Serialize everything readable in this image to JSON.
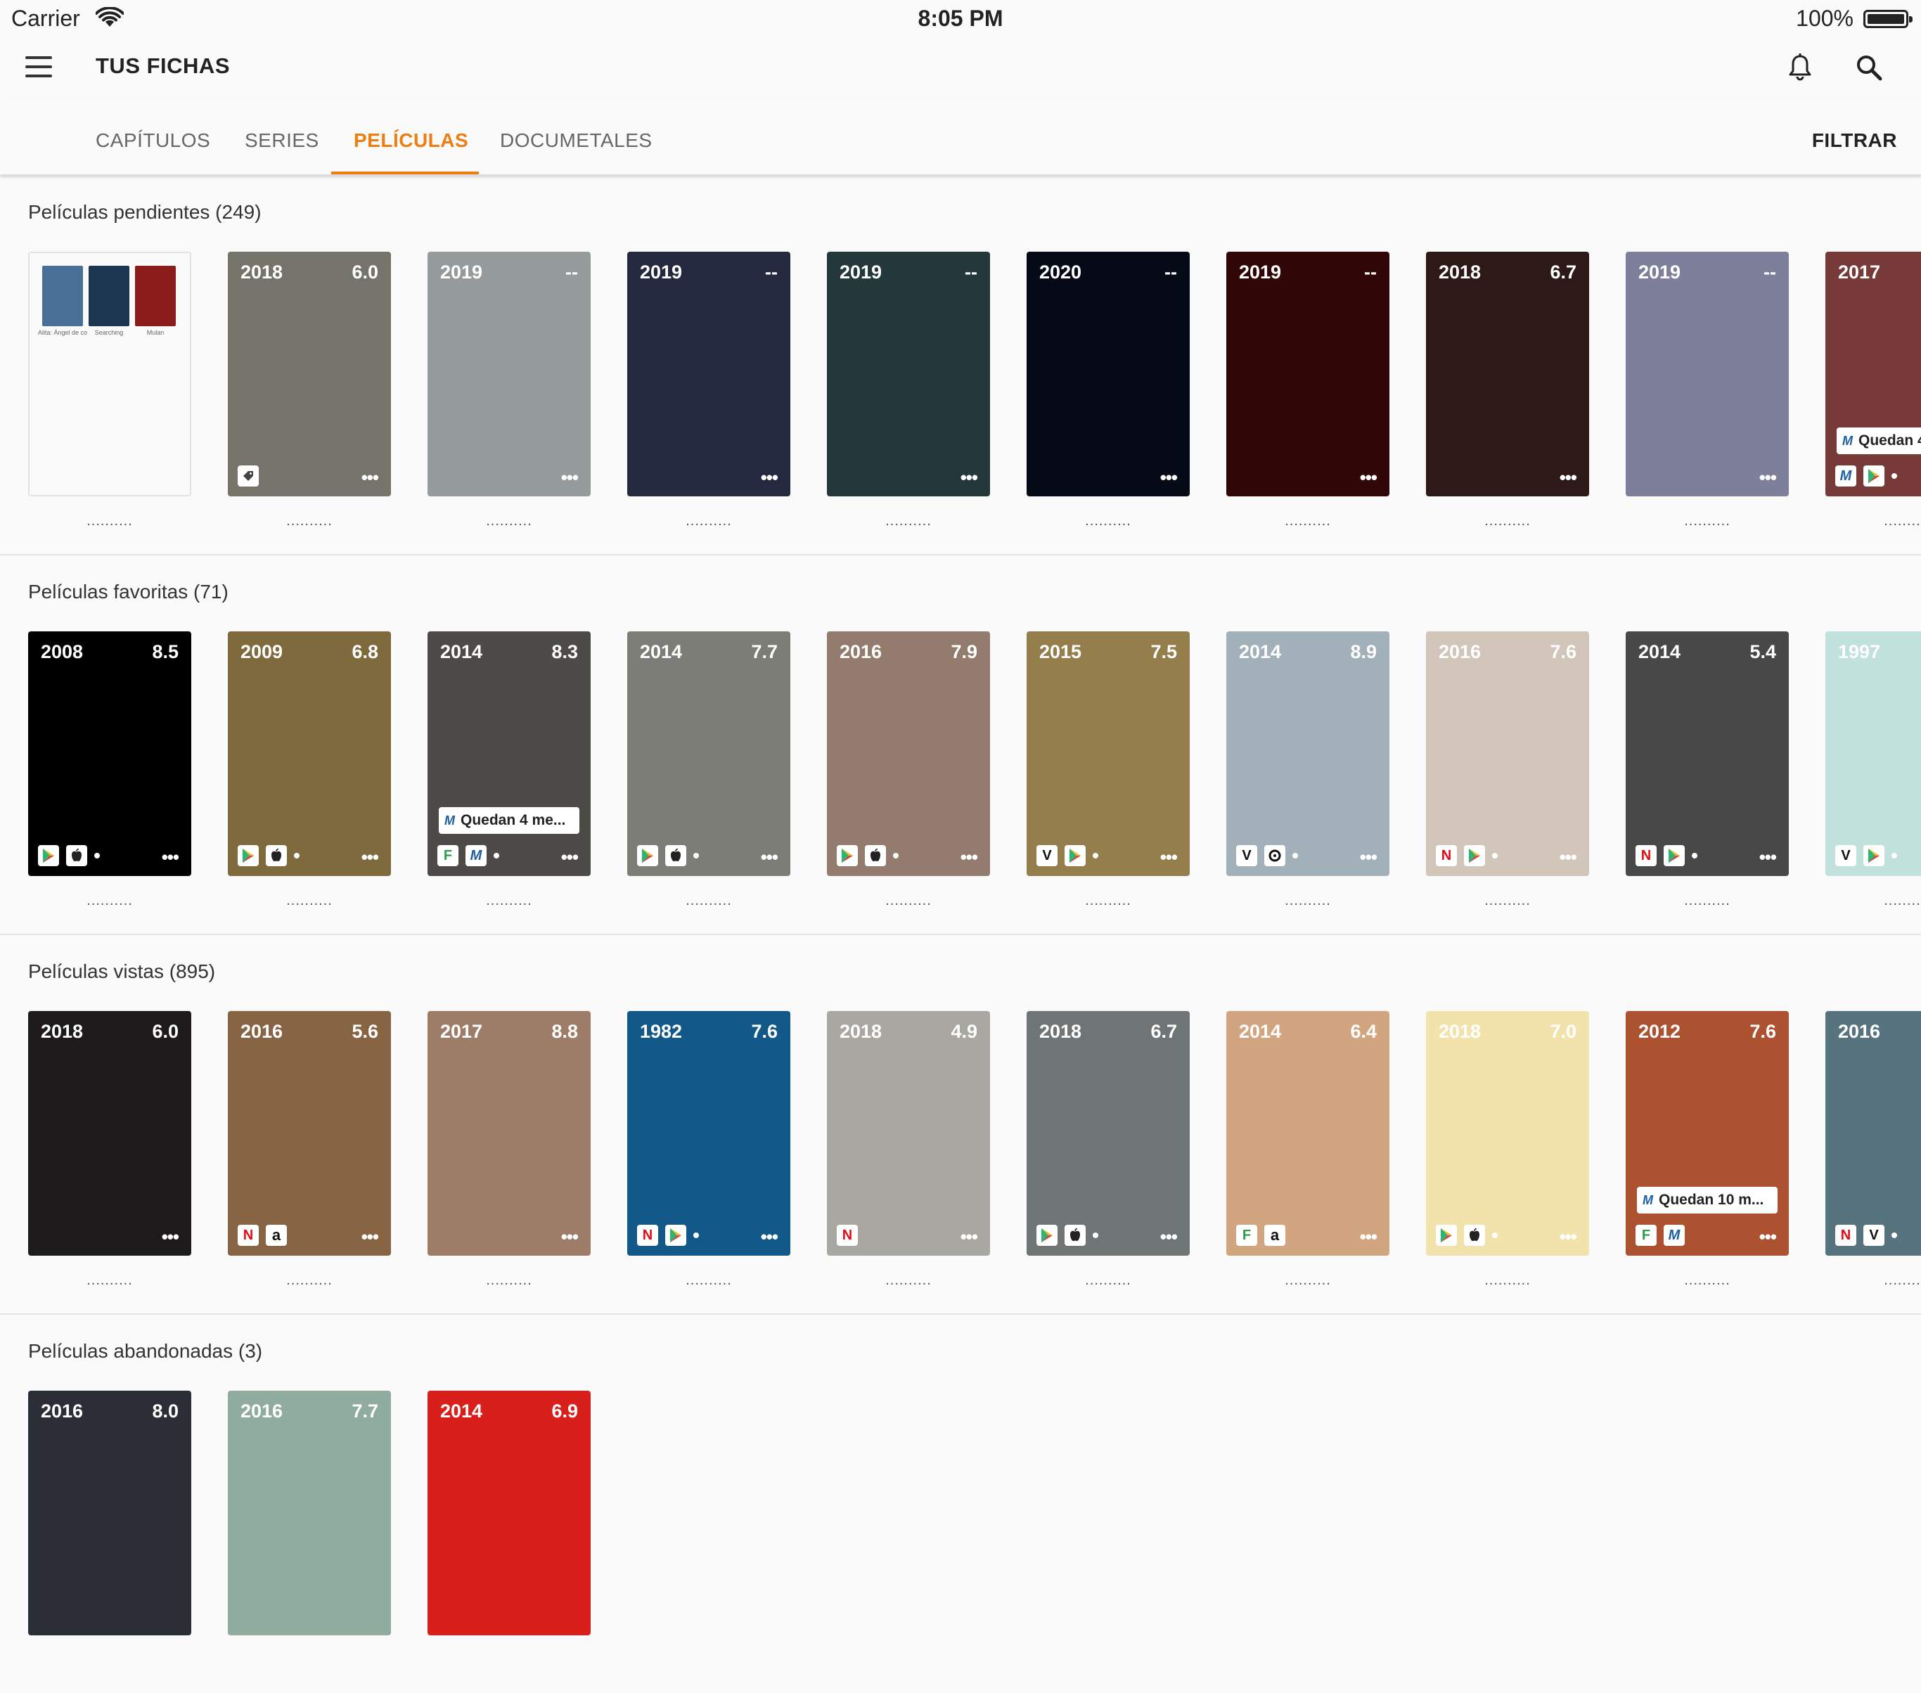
{
  "status": {
    "carrier": "Carrier",
    "time": "8:05 PM",
    "battery": "100%"
  },
  "app": {
    "title": "TUS FICHAS",
    "filter": "FILTRAR"
  },
  "tabs": [
    {
      "label": "CAPÍTULOS"
    },
    {
      "label": "SERIES"
    },
    {
      "label": "PELÍCULAS"
    },
    {
      "label": "DOCUMETALES"
    }
  ],
  "active_tab": "PELÍCULAS",
  "sections": [
    {
      "title": "Películas pendientes (249)",
      "collage": {
        "captions": [
          "Alita: Ángel de co...",
          "Searching",
          "Mulan"
        ],
        "colors": [
          "#4a6f96",
          "#1c3551",
          "#8a1c1c"
        ]
      },
      "cards": [
        {
          "year": "2018",
          "rating": "6.0",
          "color": "#75746a",
          "providers": [
            "tag"
          ],
          "caption": ".........."
        },
        {
          "year": "2019",
          "rating": "--",
          "color": "#959b9b",
          "providers": [],
          "caption": ".........."
        },
        {
          "year": "2019",
          "rating": "--",
          "color": "#242940",
          "providers": [],
          "caption": ".........."
        },
        {
          "year": "2019",
          "rating": "--",
          "color": "#24383b",
          "providers": [],
          "caption": ".........."
        },
        {
          "year": "2020",
          "rating": "--",
          "color": "#050a16",
          "providers": [],
          "caption": ".........."
        },
        {
          "year": "2019",
          "rating": "--",
          "color": "#300607",
          "providers": [],
          "caption": ".........."
        },
        {
          "year": "2018",
          "rating": "6.7",
          "color": "#2d1a16",
          "providers": [],
          "caption": ".........."
        },
        {
          "year": "2019",
          "rating": "--",
          "color": "#7e7f9a",
          "providers": [],
          "caption": ".........."
        },
        {
          "year": "2017",
          "rating": "",
          "color": "#773a38",
          "note": "Quedan 4",
          "providers": [
            "M",
            "play",
            "dot"
          ],
          "caption": ".........."
        }
      ]
    },
    {
      "title": "Películas favoritas (71)",
      "cards": [
        {
          "year": "2008",
          "rating": "8.5",
          "color": "#000000",
          "providers": [
            "play",
            "apple",
            "dot"
          ],
          "caption": ".........."
        },
        {
          "year": "2009",
          "rating": "6.8",
          "color": "#7e6a3c",
          "providers": [
            "play",
            "apple",
            "dot"
          ],
          "caption": ".........."
        },
        {
          "year": "2014",
          "rating": "8.3",
          "color": "#4d4b47",
          "note": "Quedan 4 me...",
          "providers": [
            "F",
            "M",
            "dot"
          ],
          "caption": ".........."
        },
        {
          "year": "2014",
          "rating": "7.7",
          "color": "#7d7d77",
          "providers": [
            "play",
            "apple",
            "dot"
          ],
          "caption": ".........."
        },
        {
          "year": "2016",
          "rating": "7.9",
          "color": "#937c6d",
          "providers": [
            "play",
            "apple",
            "dot"
          ],
          "caption": ".........."
        },
        {
          "year": "2015",
          "rating": "7.5",
          "color": "#937e4c",
          "providers": [
            "V",
            "play",
            "dot"
          ],
          "caption": ".........."
        },
        {
          "year": "2014",
          "rating": "8.9",
          "color": "#a2b1b9",
          "providers": [
            "V",
            "O",
            "dot"
          ],
          "caption": ".........."
        },
        {
          "year": "2016",
          "rating": "7.6",
          "color": "#d2c6ba",
          "providers": [
            "N",
            "play",
            "dot"
          ],
          "caption": ".........."
        },
        {
          "year": "2014",
          "rating": "5.4",
          "color": "#484848",
          "providers": [
            "N",
            "play",
            "dot"
          ],
          "caption": ".........."
        },
        {
          "year": "1997",
          "rating": "",
          "color": "#c0e1dc",
          "providers": [
            "V",
            "play",
            "dot"
          ],
          "caption": ".........."
        }
      ]
    },
    {
      "title": "Películas vistas (895)",
      "cards": [
        {
          "year": "2018",
          "rating": "6.0",
          "color": "#1d1a1b",
          "providers": [],
          "caption": ".........."
        },
        {
          "year": "2016",
          "rating": "5.6",
          "color": "#876544",
          "providers": [
            "N",
            "a"
          ],
          "caption": ".........."
        },
        {
          "year": "2017",
          "rating": "8.8",
          "color": "#9e7d68",
          "providers": [],
          "caption": ".........."
        },
        {
          "year": "1982",
          "rating": "7.6",
          "color": "#12598a",
          "providers": [
            "N",
            "play",
            "dot"
          ],
          "caption": ".........."
        },
        {
          "year": "2018",
          "rating": "4.9",
          "color": "#a9a7a2",
          "providers": [
            "N"
          ],
          "caption": ".........."
        },
        {
          "year": "2018",
          "rating": "6.7",
          "color": "#6f7574",
          "providers": [
            "play",
            "apple",
            "dot"
          ],
          "caption": ".........."
        },
        {
          "year": "2014",
          "rating": "6.4",
          "color": "#d1a57f",
          "providers": [
            "F",
            "a"
          ],
          "caption": ".........."
        },
        {
          "year": "2018",
          "rating": "7.0",
          "color": "#f2e3ac",
          "providers": [
            "play",
            "apple",
            "dot"
          ],
          "caption": ".........."
        },
        {
          "year": "2012",
          "rating": "7.6",
          "color": "#ac5230",
          "note": "Quedan 10 m...",
          "providers": [
            "F",
            "M"
          ],
          "caption": ".........."
        },
        {
          "year": "2016",
          "rating": "",
          "color": "#57737e",
          "providers": [
            "N",
            "V",
            "dot"
          ],
          "caption": ".........."
        }
      ]
    },
    {
      "title": "Películas abandonadas (3)",
      "cards": [
        {
          "year": "2016",
          "rating": "8.0",
          "color": "#2b2e36",
          "providers": [],
          "caption": ""
        },
        {
          "year": "2016",
          "rating": "7.7",
          "color": "#8fac9f",
          "providers": [],
          "caption": ""
        },
        {
          "year": "2014",
          "rating": "6.9",
          "color": "#d91f1c",
          "providers": [],
          "caption": ""
        }
      ]
    }
  ]
}
